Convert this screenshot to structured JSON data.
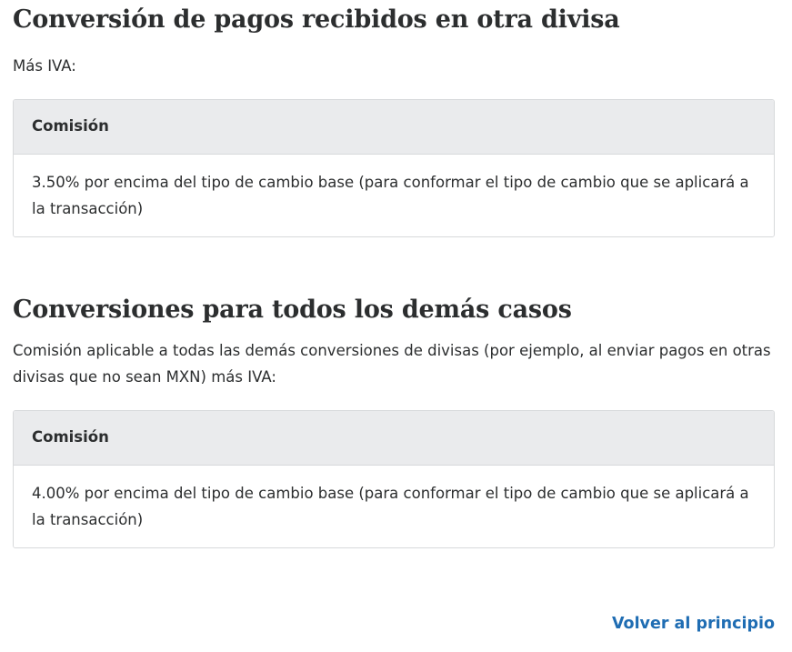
{
  "section1": {
    "heading": "Conversión de pagos recibidos en otra divisa",
    "intro": "Más IVA:",
    "table": {
      "header": "Comisión",
      "cell": "3.50% por encima del tipo de cambio base (para conformar el tipo de cambio que se aplicará a la transacción)"
    }
  },
  "section2": {
    "heading": "Conversiones para todos los demás casos",
    "intro": "Comisión aplicable a todas las demás conversiones de divisas (por ejemplo, al enviar pagos en otras divisas que no sean MXN) más IVA:",
    "table": {
      "header": "Comisión",
      "cell": "4.00% por encima del tipo de cambio base (para conformar el tipo de cambio que se aplicará a la transacción)"
    }
  },
  "footer": {
    "back_to_top": "Volver al principio"
  },
  "colors": {
    "link": "#1f6db3",
    "text": "#2c2e2f",
    "table_header_bg": "#eaebed",
    "table_border": "#d7d9db"
  }
}
